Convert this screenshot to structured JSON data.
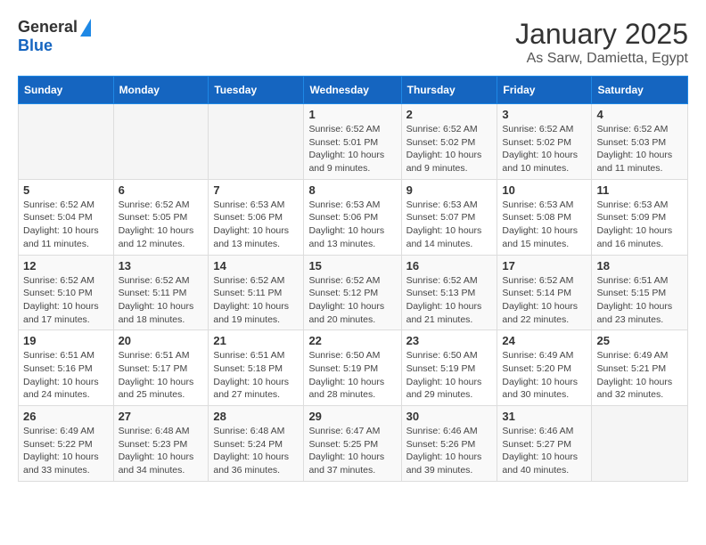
{
  "logo": {
    "general": "General",
    "blue": "Blue"
  },
  "title": "January 2025",
  "subtitle": "As Sarw, Damietta, Egypt",
  "weekdays": [
    "Sunday",
    "Monday",
    "Tuesday",
    "Wednesday",
    "Thursday",
    "Friday",
    "Saturday"
  ],
  "weeks": [
    [
      {
        "day": "",
        "info": ""
      },
      {
        "day": "",
        "info": ""
      },
      {
        "day": "",
        "info": ""
      },
      {
        "day": "1",
        "info": "Sunrise: 6:52 AM\nSunset: 5:01 PM\nDaylight: 10 hours and 9 minutes."
      },
      {
        "day": "2",
        "info": "Sunrise: 6:52 AM\nSunset: 5:02 PM\nDaylight: 10 hours and 9 minutes."
      },
      {
        "day": "3",
        "info": "Sunrise: 6:52 AM\nSunset: 5:02 PM\nDaylight: 10 hours and 10 minutes."
      },
      {
        "day": "4",
        "info": "Sunrise: 6:52 AM\nSunset: 5:03 PM\nDaylight: 10 hours and 11 minutes."
      }
    ],
    [
      {
        "day": "5",
        "info": "Sunrise: 6:52 AM\nSunset: 5:04 PM\nDaylight: 10 hours and 11 minutes."
      },
      {
        "day": "6",
        "info": "Sunrise: 6:52 AM\nSunset: 5:05 PM\nDaylight: 10 hours and 12 minutes."
      },
      {
        "day": "7",
        "info": "Sunrise: 6:53 AM\nSunset: 5:06 PM\nDaylight: 10 hours and 13 minutes."
      },
      {
        "day": "8",
        "info": "Sunrise: 6:53 AM\nSunset: 5:06 PM\nDaylight: 10 hours and 13 minutes."
      },
      {
        "day": "9",
        "info": "Sunrise: 6:53 AM\nSunset: 5:07 PM\nDaylight: 10 hours and 14 minutes."
      },
      {
        "day": "10",
        "info": "Sunrise: 6:53 AM\nSunset: 5:08 PM\nDaylight: 10 hours and 15 minutes."
      },
      {
        "day": "11",
        "info": "Sunrise: 6:53 AM\nSunset: 5:09 PM\nDaylight: 10 hours and 16 minutes."
      }
    ],
    [
      {
        "day": "12",
        "info": "Sunrise: 6:52 AM\nSunset: 5:10 PM\nDaylight: 10 hours and 17 minutes."
      },
      {
        "day": "13",
        "info": "Sunrise: 6:52 AM\nSunset: 5:11 PM\nDaylight: 10 hours and 18 minutes."
      },
      {
        "day": "14",
        "info": "Sunrise: 6:52 AM\nSunset: 5:11 PM\nDaylight: 10 hours and 19 minutes."
      },
      {
        "day": "15",
        "info": "Sunrise: 6:52 AM\nSunset: 5:12 PM\nDaylight: 10 hours and 20 minutes."
      },
      {
        "day": "16",
        "info": "Sunrise: 6:52 AM\nSunset: 5:13 PM\nDaylight: 10 hours and 21 minutes."
      },
      {
        "day": "17",
        "info": "Sunrise: 6:52 AM\nSunset: 5:14 PM\nDaylight: 10 hours and 22 minutes."
      },
      {
        "day": "18",
        "info": "Sunrise: 6:51 AM\nSunset: 5:15 PM\nDaylight: 10 hours and 23 minutes."
      }
    ],
    [
      {
        "day": "19",
        "info": "Sunrise: 6:51 AM\nSunset: 5:16 PM\nDaylight: 10 hours and 24 minutes."
      },
      {
        "day": "20",
        "info": "Sunrise: 6:51 AM\nSunset: 5:17 PM\nDaylight: 10 hours and 25 minutes."
      },
      {
        "day": "21",
        "info": "Sunrise: 6:51 AM\nSunset: 5:18 PM\nDaylight: 10 hours and 27 minutes."
      },
      {
        "day": "22",
        "info": "Sunrise: 6:50 AM\nSunset: 5:19 PM\nDaylight: 10 hours and 28 minutes."
      },
      {
        "day": "23",
        "info": "Sunrise: 6:50 AM\nSunset: 5:19 PM\nDaylight: 10 hours and 29 minutes."
      },
      {
        "day": "24",
        "info": "Sunrise: 6:49 AM\nSunset: 5:20 PM\nDaylight: 10 hours and 30 minutes."
      },
      {
        "day": "25",
        "info": "Sunrise: 6:49 AM\nSunset: 5:21 PM\nDaylight: 10 hours and 32 minutes."
      }
    ],
    [
      {
        "day": "26",
        "info": "Sunrise: 6:49 AM\nSunset: 5:22 PM\nDaylight: 10 hours and 33 minutes."
      },
      {
        "day": "27",
        "info": "Sunrise: 6:48 AM\nSunset: 5:23 PM\nDaylight: 10 hours and 34 minutes."
      },
      {
        "day": "28",
        "info": "Sunrise: 6:48 AM\nSunset: 5:24 PM\nDaylight: 10 hours and 36 minutes."
      },
      {
        "day": "29",
        "info": "Sunrise: 6:47 AM\nSunset: 5:25 PM\nDaylight: 10 hours and 37 minutes."
      },
      {
        "day": "30",
        "info": "Sunrise: 6:46 AM\nSunset: 5:26 PM\nDaylight: 10 hours and 39 minutes."
      },
      {
        "day": "31",
        "info": "Sunrise: 6:46 AM\nSunset: 5:27 PM\nDaylight: 10 hours and 40 minutes."
      },
      {
        "day": "",
        "info": ""
      }
    ]
  ]
}
